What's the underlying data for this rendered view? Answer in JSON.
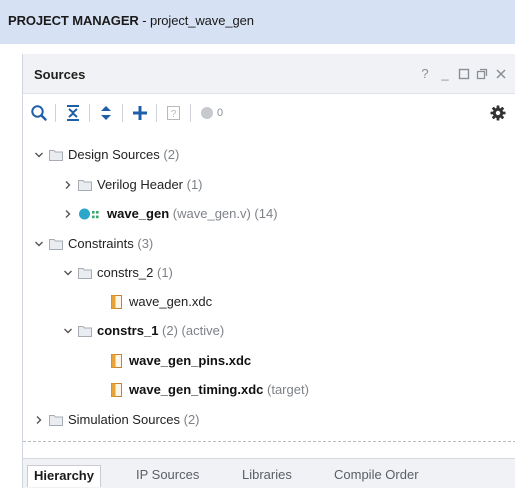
{
  "header": {
    "title_bold": "PROJECT MANAGER",
    "title_rest": " - project_wave_gen"
  },
  "panel": {
    "title": "Sources",
    "controls": [
      {
        "icon": "help-icon",
        "glyph": "?"
      },
      {
        "icon": "minimize-icon",
        "glyph": "_"
      },
      {
        "icon": "maximize-icon",
        "glyph": "☐"
      },
      {
        "icon": "float-icon",
        "glyph": "⧉"
      },
      {
        "icon": "close-icon",
        "glyph": "✕"
      }
    ]
  },
  "toolbar": {
    "buttons": [
      "search-icon",
      "collapse-all-icon",
      "expand-all-icon",
      "add-sources-icon",
      "properties-icon",
      "status-dot-icon",
      "settings-gear-icon"
    ],
    "issue_count": "0"
  },
  "tree": {
    "design_sources": {
      "label": "Design Sources",
      "count": "(2)"
    },
    "verilog_header": {
      "label": "Verilog Header",
      "count": "(1)"
    },
    "wave_gen": {
      "label": "wave_gen",
      "suffix": "(wave_gen.v) (14)"
    },
    "constraints": {
      "label": "Constraints",
      "count": "(3)"
    },
    "constrs_2": {
      "label": "constrs_2",
      "count": "(1)"
    },
    "wave_gen_xdc": {
      "label": "wave_gen.xdc"
    },
    "constrs_1": {
      "label": "constrs_1",
      "suffix": "(2) (active)"
    },
    "wave_gen_pins": {
      "label": "wave_gen_pins.xdc"
    },
    "wave_gen_timing": {
      "label": "wave_gen_timing.xdc",
      "suffix": "(target)"
    },
    "simulation_sources": {
      "label": "Simulation Sources",
      "count": "(2)"
    }
  },
  "tabs": [
    {
      "label": "Hierarchy",
      "active": true
    },
    {
      "label": "IP Sources",
      "active": false
    },
    {
      "label": "Libraries",
      "active": false
    },
    {
      "label": "Compile Order",
      "active": false
    }
  ],
  "colors": {
    "header_bg": "#d6e2f4",
    "top_module_dot": "#2ba7c9",
    "xdc_icon": "#e8a33a"
  }
}
